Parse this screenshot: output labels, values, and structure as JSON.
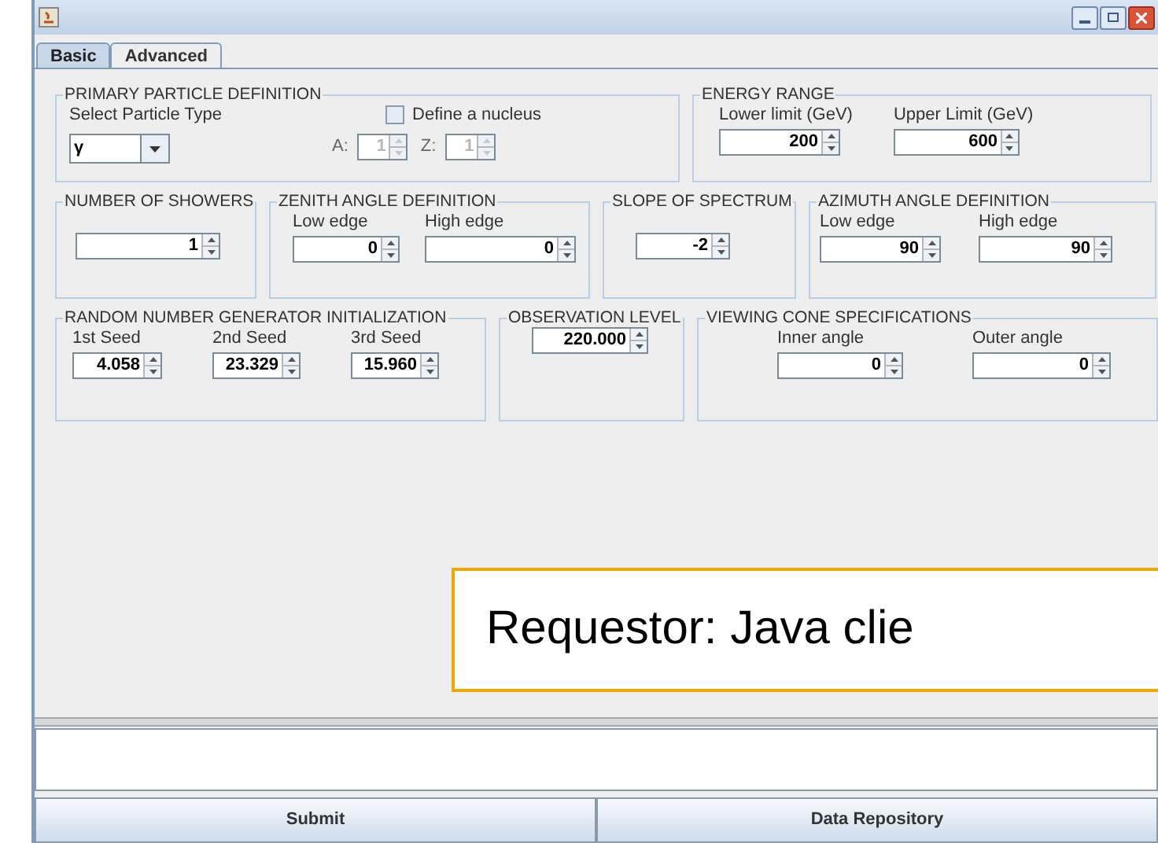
{
  "tabs": [
    {
      "label": "Basic",
      "selected": true
    },
    {
      "label": "Advanced",
      "selected": false
    }
  ],
  "rows": [
    [
      {
        "title": "PRIMARY PARTICLE DEFINITION",
        "fields": [
          {
            "kind": "combo",
            "label": "Select Particle Type",
            "value": "γ"
          },
          {
            "kind": "nucleus",
            "checkbox": {
              "label": "Define a nucleus",
              "checked": false
            },
            "spinners": [
              {
                "label": "A:",
                "value": "1",
                "disabled": true
              },
              {
                "label": "Z:",
                "value": "1",
                "disabled": true
              }
            ]
          }
        ]
      },
      {
        "title": "ENERGY RANGE",
        "fields": [
          {
            "kind": "spinner",
            "label": "Lower limit (GeV)",
            "value": "200",
            "disabled": false
          },
          {
            "kind": "spinner",
            "label": "Upper Limit (GeV)",
            "value": "600",
            "disabled": false
          }
        ]
      }
    ],
    [
      {
        "title": "NUMBER OF SHOWERS",
        "fields": [
          {
            "kind": "spinner",
            "value": "1",
            "disabled": false
          }
        ]
      },
      {
        "title": "ZENITH ANGLE DEFINITION",
        "fields": [
          {
            "kind": "spinner",
            "label": "Low edge",
            "value": "0",
            "disabled": false
          },
          {
            "kind": "spinner",
            "label": "High edge",
            "value": "0",
            "disabled": false
          }
        ]
      },
      {
        "title": "SLOPE OF SPECTRUM",
        "fields": [
          {
            "kind": "spinner",
            "value": "-2",
            "disabled": false
          }
        ]
      },
      {
        "title": "AZIMUTH ANGLE DEFINITION",
        "fields": [
          {
            "kind": "spinner",
            "label": "Low edge",
            "value": "90",
            "disabled": false
          },
          {
            "kind": "spinner",
            "label": "High edge",
            "value": "90",
            "disabled": false
          }
        ]
      }
    ],
    [
      {
        "title": "RANDOM NUMBER GENERATOR INITIALIZATION",
        "fields": [
          {
            "kind": "spinner",
            "label": "1st Seed",
            "value": "4.058",
            "disabled": false
          },
          {
            "kind": "spinner",
            "label": "2nd Seed",
            "value": "23.329",
            "disabled": false
          },
          {
            "kind": "spinner",
            "label": "3rd Seed",
            "value": "15.960",
            "disabled": false
          }
        ]
      },
      {
        "title": "OBSERVATION LEVEL",
        "fields": [
          {
            "kind": "spinner",
            "value": "220.000",
            "disabled": false
          }
        ]
      },
      {
        "title": "VIEWING CONE SPECIFICATIONS",
        "fields": [
          {
            "kind": "spinner",
            "label": "Inner angle",
            "value": "0",
            "disabled": false
          },
          {
            "kind": "spinner",
            "label": "Outer angle",
            "value": "0",
            "disabled": false
          }
        ]
      }
    ]
  ],
  "callout": {
    "text": "Requestor: Java clie"
  },
  "buttons": [
    {
      "label": "Submit"
    },
    {
      "label": "Data Repository"
    }
  ]
}
